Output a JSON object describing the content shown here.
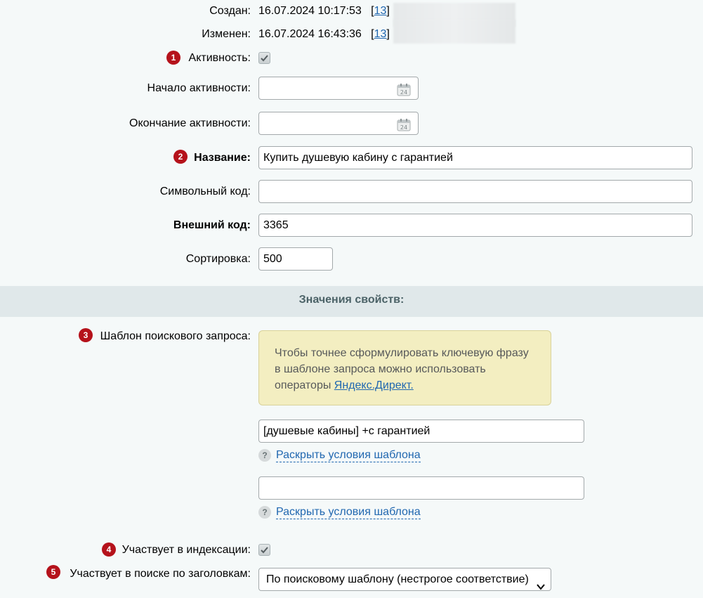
{
  "meta": {
    "created_label": "Создан:",
    "created_value": "16.07.2024 10:17:53",
    "created_user_open": "[",
    "created_user_id": "13",
    "created_user_close": "]",
    "modified_label": "Изменен:",
    "modified_value": "16.07.2024 16:43:36",
    "modified_user_open": "[",
    "modified_user_id": "13",
    "modified_user_close": "]"
  },
  "badges": [
    "1",
    "2",
    "3",
    "4",
    "5"
  ],
  "fields": {
    "active_label": "Активность:",
    "active_checked": true,
    "active_from_label": "Начало активности:",
    "active_from_value": "",
    "active_to_label": "Окончание активности:",
    "active_to_value": "",
    "name_label": "Название:",
    "name_value": "Купить душевую кабину с гарантией",
    "code_label": "Символьный код:",
    "code_value": "",
    "xml_id_label": "Внешний код:",
    "xml_id_value": "3365",
    "sort_label": "Сортировка:",
    "sort_value": "500"
  },
  "section_title": "Значения свойств:",
  "properties": {
    "template_label": "Шаблон поискового запроса:",
    "hint_text": "Чтобы точнее сформулировать ключевую фразу в шаблоне запроса можно использовать операторы ",
    "hint_link": "Яндекс.Директ.",
    "template_value_1": "[душевые кабины] +с гарантией",
    "template_value_2": "",
    "expand_label_1": "Раскрыть условия шаблона",
    "expand_label_2": "Раскрыть условия шаблона",
    "help_glyph": "?",
    "indexing_label": "Участвует в индексации:",
    "indexing_checked": true,
    "title_search_label": "Участвует в поиске по заголовкам:",
    "title_search_value": "По поисковому шаблону (нестрогое соответствие)"
  },
  "colors": {
    "badge": "#b5121b",
    "link": "#2067b0",
    "hint_bg": "#f3eec1",
    "section_bg": "#e0e8ea"
  }
}
